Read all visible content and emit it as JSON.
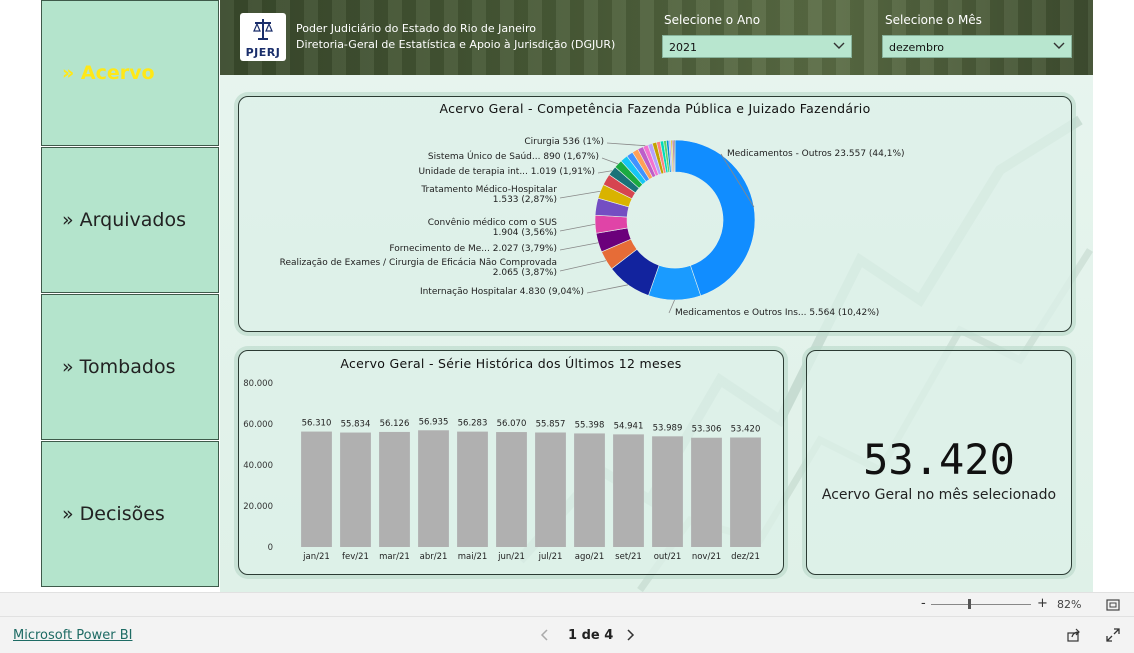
{
  "nav": {
    "items": [
      {
        "label": "» Acervo",
        "active": true
      },
      {
        "label": "» Arquivados",
        "active": false
      },
      {
        "label": "» Tombados",
        "active": false
      },
      {
        "label": "» Decisões",
        "active": false
      }
    ]
  },
  "header": {
    "logo_text": "PJERJ",
    "line1": "Poder Judiciário do Estado do Rio de Janeiro",
    "line2": "Diretoria-Geral de Estatística e Apoio à Jurisdição (DGJUR)",
    "year_label": "Selecione o Ano",
    "year_value": "2021",
    "month_label": "Selecione o Mês",
    "month_value": "dezembro"
  },
  "kpi": {
    "value": "53.420",
    "caption": "Acervo Geral no mês selecionado"
  },
  "statusbar": {
    "zoom": "82%",
    "minus": "-",
    "plus": "+"
  },
  "footer": {
    "brand": "Microsoft Power BI",
    "page_indicator": "1 de 4"
  },
  "colors": {
    "nav_bg": "#b4e4cc",
    "nav_active_text": "#ffe817",
    "bar_fill": "#b0b0b0",
    "slicer_bg": "#b8e6cf"
  },
  "icons": [
    "chevron-down-icon",
    "chevron-left-icon",
    "chevron-right-icon",
    "share-icon",
    "expand-icon",
    "fit-page-icon",
    "scale-of-justice-icon"
  ],
  "chart_data": [
    {
      "type": "pie",
      "title": "Acervo Geral - Competência Fazenda Pública e Juizado Fazendário",
      "donut": true,
      "slices": [
        {
          "label": "Medicamentos - Outros",
          "value": 23557,
          "display": "23.557 (44,1%)",
          "color": "#118dff",
          "show_label": true
        },
        {
          "label": "Medicamentos e Outros Ins...",
          "value": 5564,
          "display": "5.564 (10,42%)",
          "color": "#1a9bff",
          "show_label": true
        },
        {
          "label": "Internação Hospitalar",
          "value": 4830,
          "display": "4.830 (9,04%)",
          "color": "#12239e",
          "show_label": true
        },
        {
          "label": "Realização de Exames / Cirurgia de Eficácia Não Comprovada",
          "value": 2065,
          "display": "2.065 (3,87%)",
          "color": "#e66c37",
          "show_label": true
        },
        {
          "label": "Fornecimento de Me...",
          "value": 2027,
          "display": "2.027 (3,79%)",
          "color": "#6b007b",
          "show_label": true
        },
        {
          "label": "Convênio médico com o SUS",
          "value": 1904,
          "display": "1.904 (3,56%)",
          "color": "#e044a7",
          "show_label": true
        },
        {
          "label": "",
          "value": 1800,
          "display": "",
          "color": "#744ec2",
          "show_label": false
        },
        {
          "label": "Tratamento Médico-Hospitalar",
          "value": 1533,
          "display": "1.533 (2,87%)",
          "color": "#d9b300",
          "show_label": true
        },
        {
          "label": "",
          "value": 1200,
          "display": "",
          "color": "#d64550",
          "show_label": false
        },
        {
          "label": "Unidade de terapia int...",
          "value": 1019,
          "display": "1.019 (1,91%)",
          "color": "#197278",
          "show_label": true
        },
        {
          "label": "Sistema Único de Saúd...",
          "value": 890,
          "display": "890 (1,67%)",
          "color": "#1aab40",
          "show_label": true
        },
        {
          "label": "",
          "value": 800,
          "display": "",
          "color": "#15c6f4",
          "show_label": false
        },
        {
          "label": "",
          "value": 700,
          "display": "",
          "color": "#4092ff",
          "show_label": false
        },
        {
          "label": "",
          "value": 650,
          "display": "",
          "color": "#ffa058",
          "show_label": false
        },
        {
          "label": "",
          "value": 600,
          "display": "",
          "color": "#be5dc9",
          "show_label": false
        },
        {
          "label": "Cirurgia",
          "value": 536,
          "display": "536 (1%)",
          "color": "#f472d0",
          "show_label": true
        },
        {
          "label": "",
          "value": 500,
          "display": "",
          "color": "#b5a1ff",
          "show_label": false
        },
        {
          "label": "",
          "value": 450,
          "display": "",
          "color": "#c4a200",
          "show_label": false
        },
        {
          "label": "",
          "value": 400,
          "display": "",
          "color": "#ff8080",
          "show_label": false
        },
        {
          "label": "",
          "value": 350,
          "display": "",
          "color": "#00dbbc",
          "show_label": false
        },
        {
          "label": "",
          "value": 300,
          "display": "",
          "color": "#5bd667",
          "show_label": false
        },
        {
          "label": "",
          "value": 250,
          "display": "",
          "color": "#0091d5",
          "show_label": false
        },
        {
          "label": "",
          "value": 200,
          "display": "",
          "color": "#b6b0ff",
          "show_label": false
        },
        {
          "label": "",
          "value": 180,
          "display": "",
          "color": "#e8cb4a",
          "show_label": false
        },
        {
          "label": "",
          "value": 150,
          "display": "",
          "color": "#a43b76",
          "show_label": false
        },
        {
          "label": "",
          "value": 130,
          "display": "",
          "color": "#7f7f7f",
          "show_label": false
        }
      ]
    },
    {
      "type": "bar",
      "title": "Acervo Geral - Série Histórica dos Últimos 12 meses",
      "categories": [
        "jan/21",
        "fev/21",
        "mar/21",
        "abr/21",
        "mai/21",
        "jun/21",
        "jul/21",
        "ago/21",
        "set/21",
        "out/21",
        "nov/21",
        "dez/21"
      ],
      "values": [
        56310,
        55834,
        56126,
        56935,
        56283,
        56070,
        55857,
        55398,
        54941,
        53989,
        53306,
        53420
      ],
      "data_labels": [
        "56.310",
        "55.834",
        "56.126",
        "56.935",
        "56.283",
        "56.070",
        "55.857",
        "55.398",
        "54.941",
        "53.989",
        "53.306",
        "53.420"
      ],
      "ylim": [
        0,
        80000
      ],
      "yticks": [
        "0",
        "20.000",
        "40.000",
        "60.000",
        "80.000"
      ],
      "ytick_values": [
        0,
        20000,
        40000,
        60000,
        80000
      ],
      "grid": false
    }
  ]
}
